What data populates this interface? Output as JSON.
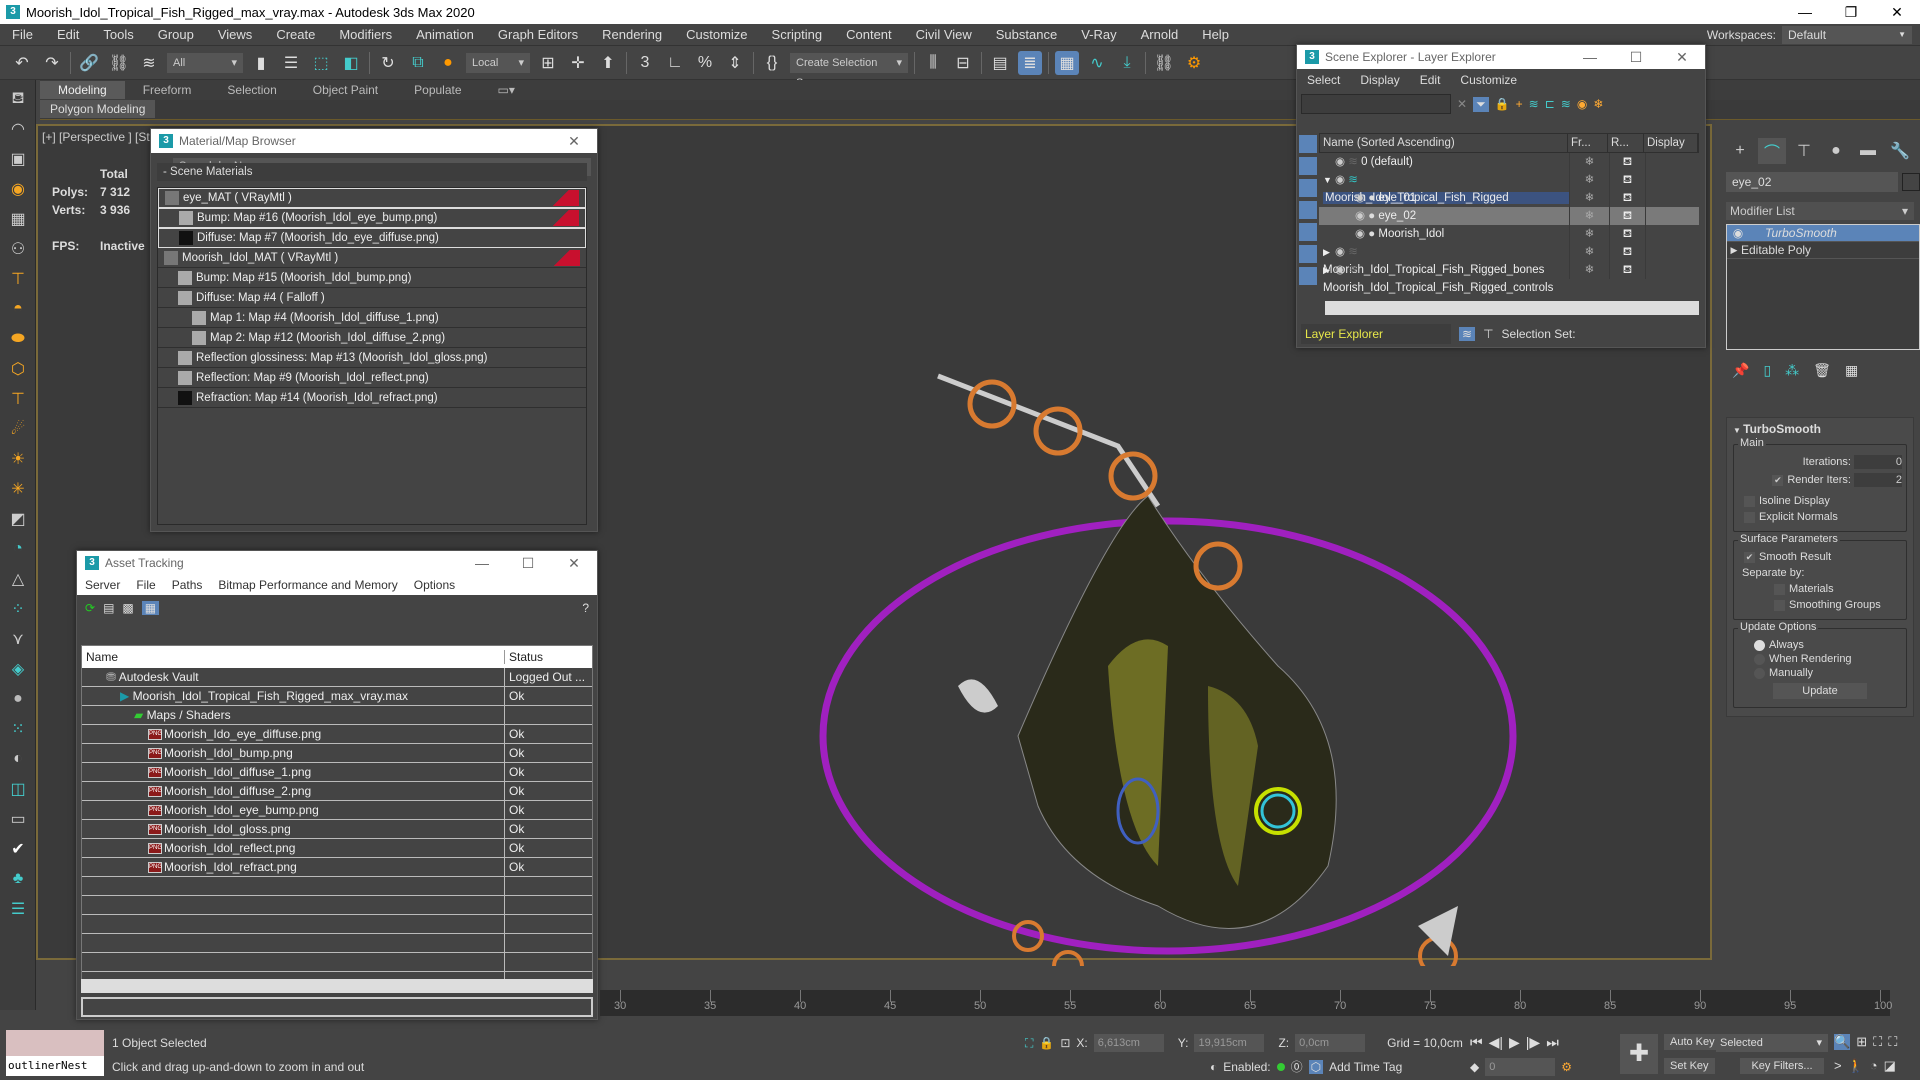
{
  "window": {
    "title": "Moorish_Idol_Tropical_Fish_Rigged_max_vray.max - Autodesk 3ds Max 2020",
    "minimize": "—",
    "restore": "❐",
    "close": "✕"
  },
  "menubar": {
    "items": [
      "File",
      "Edit",
      "Tools",
      "Group",
      "Views",
      "Create",
      "Modifiers",
      "Animation",
      "Graph Editors",
      "Rendering",
      "Customize",
      "Scripting",
      "Content",
      "Civil View",
      "Substance",
      "V-Ray",
      "Arnold",
      "Help"
    ],
    "workspaces_label": "Workspaces:",
    "workspaces_value": "Default"
  },
  "toolbar": {
    "filter_value": "All",
    "coord_system": "Local",
    "selection_set": "Create Selection Se"
  },
  "ribbon": {
    "tabs": [
      "Modeling",
      "Freeform",
      "Selection",
      "Object Paint",
      "Populate"
    ],
    "active_tab": "Modeling",
    "sub_label": "Polygon Modeling"
  },
  "viewport": {
    "label": "[+] [Perspective ] [St",
    "stats": {
      "total_label": "Total",
      "polys_label": "Polys:",
      "polys_value": "7 312",
      "verts_label": "Verts:",
      "verts_value": "3 936",
      "fps_label": "FPS:",
      "fps_value": "Inactive"
    }
  },
  "material_browser": {
    "title": "Material/Map Browser",
    "search_placeholder": "Search by Name ...",
    "section": "- Scene Materials",
    "rows": [
      {
        "label": "eye_MAT  ( VRayMtl )",
        "level": 0,
        "flag": true
      },
      {
        "label": "Bump: Map #16 (Moorish_Idol_eye_bump.png)",
        "level": 1,
        "flag": true
      },
      {
        "label": "Diffuse: Map #7 (Moorish_Ido_eye_diffuse.png)",
        "level": 1,
        "flag": false
      },
      {
        "label": "Moorish_Idol_MAT  ( VRayMtl )",
        "level": 0,
        "flag": true
      },
      {
        "label": "Bump: Map #15 (Moorish_Idol_bump.png)",
        "level": 1,
        "flag": false
      },
      {
        "label": "Diffuse: Map #4  ( Falloff )",
        "level": 1,
        "flag": false
      },
      {
        "label": "Map 1: Map #4 (Moorish_Idol_diffuse_1.png)",
        "level": 2,
        "flag": false
      },
      {
        "label": "Map 2: Map #12 (Moorish_Idol_diffuse_2.png)",
        "level": 2,
        "flag": false
      },
      {
        "label": "Reflection glossiness: Map #13 (Moorish_Idol_gloss.png)",
        "level": 1,
        "flag": false
      },
      {
        "label": "Reflection: Map #9 (Moorish_Idol_reflect.png)",
        "level": 1,
        "flag": false
      },
      {
        "label": "Refraction: Map #14 (Moorish_Idol_refract.png)",
        "level": 1,
        "flag": false
      }
    ]
  },
  "asset_tracking": {
    "title": "Asset Tracking",
    "menu": [
      "Server",
      "File",
      "Paths",
      "Bitmap Performance and Memory",
      "Options"
    ],
    "columns": [
      "Name",
      "Status"
    ],
    "rows": [
      {
        "name": "Autodesk Vault",
        "status": "Logged Out ...",
        "level": 0,
        "icon": "vault"
      },
      {
        "name": "Moorish_Idol_Tropical_Fish_Rigged_max_vray.max",
        "status": "Ok",
        "level": 1,
        "icon": "max"
      },
      {
        "name": "Maps / Shaders",
        "status": "",
        "level": 2,
        "icon": "maps"
      },
      {
        "name": "Moorish_Ido_eye_diffuse.png",
        "status": "Ok",
        "level": 3,
        "icon": "png"
      },
      {
        "name": "Moorish_Idol_bump.png",
        "status": "Ok",
        "level": 3,
        "icon": "png"
      },
      {
        "name": "Moorish_Idol_diffuse_1.png",
        "status": "Ok",
        "level": 3,
        "icon": "png"
      },
      {
        "name": "Moorish_Idol_diffuse_2.png",
        "status": "Ok",
        "level": 3,
        "icon": "png"
      },
      {
        "name": "Moorish_Idol_eye_bump.png",
        "status": "Ok",
        "level": 3,
        "icon": "png"
      },
      {
        "name": "Moorish_Idol_gloss.png",
        "status": "Ok",
        "level": 3,
        "icon": "png"
      },
      {
        "name": "Moorish_Idol_reflect.png",
        "status": "Ok",
        "level": 3,
        "icon": "png"
      },
      {
        "name": "Moorish_Idol_refract.png",
        "status": "Ok",
        "level": 3,
        "icon": "png"
      }
    ]
  },
  "scene_explorer": {
    "title": "Scene Explorer - Layer Explorer",
    "menu": [
      "Select",
      "Display",
      "Edit",
      "Customize"
    ],
    "columns": [
      "Name (Sorted Ascending)",
      "Fr...",
      "R...",
      "Display"
    ],
    "rows": [
      {
        "name": "0 (default)",
        "level": 0,
        "type": "layer",
        "expand": "",
        "state": ""
      },
      {
        "name": "Moorish_Idol_Tropical_Fish_Rigged",
        "level": 0,
        "type": "layer-active",
        "expand": "open",
        "state": "highlight"
      },
      {
        "name": "eye_01",
        "level": 1,
        "type": "object",
        "expand": "",
        "state": ""
      },
      {
        "name": "eye_02",
        "level": 1,
        "type": "object",
        "expand": "",
        "state": "selected"
      },
      {
        "name": "Moorish_Idol",
        "level": 1,
        "type": "object",
        "expand": "",
        "state": ""
      },
      {
        "name": "Moorish_Idol_Tropical_Fish_Rigged_bones",
        "level": 0,
        "type": "layer",
        "expand": "closed",
        "state": ""
      },
      {
        "name": "Moorish_Idol_Tropical_Fish_Rigged_controls",
        "level": 0,
        "type": "layer",
        "expand": "closed",
        "state": ""
      }
    ],
    "explorer_type": "Layer Explorer",
    "selection_set_label": "Selection Set:"
  },
  "command_panel": {
    "object_name": "eye_02",
    "modifier_list": "Modifier List",
    "stack": [
      {
        "name": "TurboSmooth",
        "selected": true
      },
      {
        "name": "Editable Poly",
        "selected": false
      }
    ],
    "rollout": {
      "title": "TurboSmooth",
      "main_label": "Main",
      "iterations_label": "Iterations:",
      "iterations_value": "0",
      "render_iters_label": "Render Iters:",
      "render_iters_value": "2",
      "render_iters_checked": true,
      "isoline_label": "Isoline Display",
      "isoline_checked": false,
      "explicit_normals_label": "Explicit Normals",
      "explicit_normals_checked": false,
      "surface_label": "Surface Parameters",
      "smooth_result_label": "Smooth Result",
      "smooth_result_checked": true,
      "separate_by_label": "Separate by:",
      "materials_label": "Materials",
      "smoothing_groups_label": "Smoothing Groups",
      "update_options_label": "Update Options",
      "always_label": "Always",
      "when_rendering_label": "When Rendering",
      "manually_label": "Manually",
      "update_mode": "Always",
      "update_button": "Update"
    }
  },
  "timeline": {
    "ticks": [
      "30",
      "35",
      "40",
      "45",
      "50",
      "55",
      "60",
      "65",
      "70",
      "75",
      "80",
      "85",
      "90",
      "95",
      "100"
    ]
  },
  "status": {
    "maxscript_value": "outlinerNest",
    "selection": "1 Object Selected",
    "prompt": "Click and drag up-and-down to zoom in and out",
    "x_label": "X:",
    "x_value": "6,613cm",
    "y_label": "Y:",
    "y_value": "19,915cm",
    "z_label": "Z:",
    "z_value": "0,0cm",
    "grid": "Grid = 10,0cm",
    "enabled_label": "Enabled:",
    "add_time_tag": "Add Time Tag",
    "frame_value": "0",
    "auto_key": "Auto Key",
    "set_key": "Set Key",
    "key_mode": "Selected",
    "key_filters": "Key Filters..."
  },
  "colors": {
    "accent": "#5b84b8",
    "viewport_border": "#7a6a3a",
    "selection_ring": "#a020c0",
    "rig_orange": "#d87a30"
  }
}
